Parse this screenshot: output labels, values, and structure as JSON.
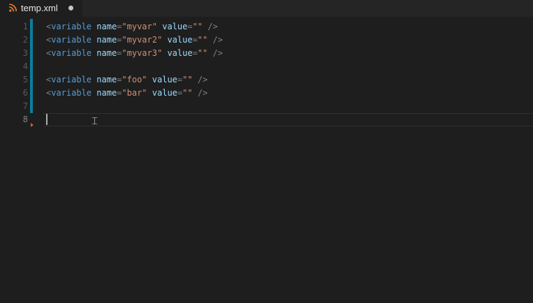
{
  "tab": {
    "icon": "rss-icon",
    "icon_color": "#e37933",
    "label": "temp.xml",
    "modified": true
  },
  "editor": {
    "current_line": 8,
    "lines": [
      {
        "number": "1",
        "tokens": [
          {
            "t": "punct",
            "v": "<"
          },
          {
            "t": "tag",
            "v": "variable"
          },
          {
            "t": "text",
            "v": " "
          },
          {
            "t": "attr",
            "v": "name"
          },
          {
            "t": "punct",
            "v": "="
          },
          {
            "t": "str",
            "v": "\"myvar\""
          },
          {
            "t": "text",
            "v": " "
          },
          {
            "t": "attr",
            "v": "value"
          },
          {
            "t": "punct",
            "v": "="
          },
          {
            "t": "str",
            "v": "\"\""
          },
          {
            "t": "text",
            "v": " "
          },
          {
            "t": "punct",
            "v": "/>"
          }
        ]
      },
      {
        "number": "2",
        "tokens": [
          {
            "t": "punct",
            "v": "<"
          },
          {
            "t": "tag",
            "v": "variable"
          },
          {
            "t": "text",
            "v": " "
          },
          {
            "t": "attr",
            "v": "name"
          },
          {
            "t": "punct",
            "v": "="
          },
          {
            "t": "str",
            "v": "\"myvar2\""
          },
          {
            "t": "text",
            "v": " "
          },
          {
            "t": "attr",
            "v": "value"
          },
          {
            "t": "punct",
            "v": "="
          },
          {
            "t": "str",
            "v": "\"\""
          },
          {
            "t": "text",
            "v": " "
          },
          {
            "t": "punct",
            "v": "/>"
          }
        ]
      },
      {
        "number": "3",
        "tokens": [
          {
            "t": "punct",
            "v": "<"
          },
          {
            "t": "tag",
            "v": "variable"
          },
          {
            "t": "text",
            "v": " "
          },
          {
            "t": "attr",
            "v": "name"
          },
          {
            "t": "punct",
            "v": "="
          },
          {
            "t": "str",
            "v": "\"myvar3\""
          },
          {
            "t": "text",
            "v": " "
          },
          {
            "t": "attr",
            "v": "value"
          },
          {
            "t": "punct",
            "v": "="
          },
          {
            "t": "str",
            "v": "\"\""
          },
          {
            "t": "text",
            "v": " "
          },
          {
            "t": "punct",
            "v": "/>"
          }
        ]
      },
      {
        "number": "4",
        "tokens": []
      },
      {
        "number": "5",
        "tokens": [
          {
            "t": "punct",
            "v": "<"
          },
          {
            "t": "tag",
            "v": "variable"
          },
          {
            "t": "text",
            "v": " "
          },
          {
            "t": "attr",
            "v": "name"
          },
          {
            "t": "punct",
            "v": "="
          },
          {
            "t": "str",
            "v": "\"foo\""
          },
          {
            "t": "text",
            "v": " "
          },
          {
            "t": "attr",
            "v": "value"
          },
          {
            "t": "punct",
            "v": "="
          },
          {
            "t": "str",
            "v": "\"\""
          },
          {
            "t": "text",
            "v": " "
          },
          {
            "t": "punct",
            "v": "/>"
          }
        ]
      },
      {
        "number": "6",
        "tokens": [
          {
            "t": "punct",
            "v": "<"
          },
          {
            "t": "tag",
            "v": "variable"
          },
          {
            "t": "text",
            "v": " "
          },
          {
            "t": "attr",
            "v": "name"
          },
          {
            "t": "punct",
            "v": "="
          },
          {
            "t": "str",
            "v": "\"bar\""
          },
          {
            "t": "text",
            "v": " "
          },
          {
            "t": "attr",
            "v": "value"
          },
          {
            "t": "punct",
            "v": "="
          },
          {
            "t": "str",
            "v": "\"\""
          },
          {
            "t": "text",
            "v": " "
          },
          {
            "t": "punct",
            "v": "/>"
          }
        ]
      },
      {
        "number": "7",
        "tokens": []
      },
      {
        "number": "8",
        "tokens": []
      }
    ],
    "added_lines": [
      1,
      7
    ],
    "fold_marker_after_line": 8,
    "colors": {
      "tag": "#569cd6",
      "attr": "#9cdcfe",
      "string": "#ce9178",
      "punct": "#808080",
      "added_bar": "#0c7d9d",
      "fold_marker": "#c5652a"
    }
  }
}
